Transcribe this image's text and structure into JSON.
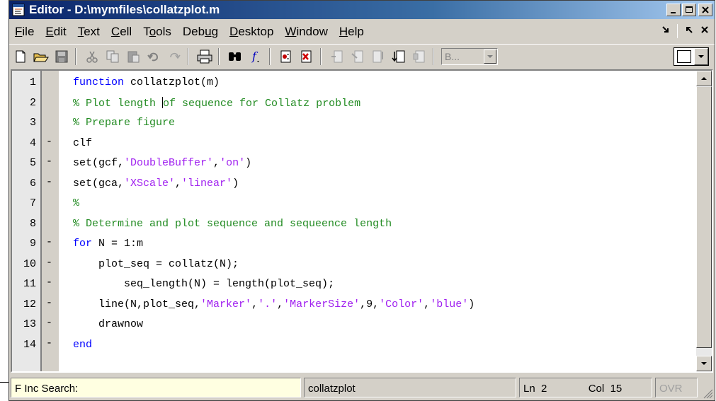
{
  "window": {
    "title": "Editor - D:\\mymfiles\\collatzplot.m"
  },
  "menu": {
    "items": [
      {
        "label": "File",
        "key": "F",
        "rest": "ile"
      },
      {
        "label": "Edit",
        "key": "E",
        "rest": "dit"
      },
      {
        "label": "Text",
        "key": "T",
        "rest": "ext"
      },
      {
        "label": "Cell",
        "key": "C",
        "rest": "ell"
      },
      {
        "label": "Tools",
        "pre": "T",
        "key": "o",
        "rest": "ols"
      },
      {
        "label": "Debug",
        "pre": "Deb",
        "key": "u",
        "rest": "g"
      },
      {
        "label": "Desktop",
        "key": "D",
        "rest": "esktop"
      },
      {
        "label": "Window",
        "key": "W",
        "rest": "indow"
      },
      {
        "label": "Help",
        "key": "H",
        "rest": "elp"
      }
    ],
    "right_undock": "↘",
    "right_close": "✕"
  },
  "toolbar": {
    "stack_combo": "B...",
    "icons": [
      "new-file-icon",
      "open-folder-icon",
      "save-icon",
      "cut-icon",
      "copy-icon",
      "paste-icon",
      "undo-icon",
      "redo-icon",
      "print-icon",
      "find-icon",
      "function-icon",
      "set-breakpoint-icon",
      "clear-breakpoint-icon",
      "step-icon",
      "step-in-icon",
      "step-out-icon",
      "continue-icon",
      "exit-debug-icon"
    ]
  },
  "code_lines": [
    {
      "num": "1",
      "bp": "",
      "indent": "",
      "parts": [
        {
          "t": "kw",
          "v": "function"
        },
        {
          "t": "n",
          "v": " collatzplot(m)"
        }
      ]
    },
    {
      "num": "2",
      "bp": "",
      "indent": "",
      "parts": [
        {
          "t": "cm",
          "v": "% Plot length "
        },
        {
          "t": "caret",
          "v": ""
        },
        {
          "t": "cm",
          "v": "of sequence for Collatz problem"
        }
      ]
    },
    {
      "num": "3",
      "bp": "",
      "indent": "",
      "parts": [
        {
          "t": "cm",
          "v": "% Prepare figure"
        }
      ]
    },
    {
      "num": "4",
      "bp": "-",
      "indent": "",
      "parts": [
        {
          "t": "n",
          "v": "clf"
        }
      ]
    },
    {
      "num": "5",
      "bp": "-",
      "indent": "",
      "parts": [
        {
          "t": "n",
          "v": "set(gcf,"
        },
        {
          "t": "st",
          "v": "'DoubleBuffer'"
        },
        {
          "t": "n",
          "v": ","
        },
        {
          "t": "st",
          "v": "'on'"
        },
        {
          "t": "n",
          "v": ")"
        }
      ]
    },
    {
      "num": "6",
      "bp": "-",
      "indent": "",
      "parts": [
        {
          "t": "n",
          "v": "set(gca,"
        },
        {
          "t": "st",
          "v": "'XScale'"
        },
        {
          "t": "n",
          "v": ","
        },
        {
          "t": "st",
          "v": "'linear'"
        },
        {
          "t": "n",
          "v": ")"
        }
      ]
    },
    {
      "num": "7",
      "bp": "",
      "indent": "",
      "parts": [
        {
          "t": "cm",
          "v": "%"
        }
      ]
    },
    {
      "num": "8",
      "bp": "",
      "indent": "",
      "parts": [
        {
          "t": "cm",
          "v": "% Determine and plot sequence and sequeence length"
        }
      ]
    },
    {
      "num": "9",
      "bp": "-",
      "indent": "",
      "parts": [
        {
          "t": "kw",
          "v": "for"
        },
        {
          "t": "n",
          "v": " N = 1:m"
        }
      ]
    },
    {
      "num": "10",
      "bp": "-",
      "indent": "    ",
      "parts": [
        {
          "t": "n",
          "v": "plot_seq = collatz(N);"
        }
      ]
    },
    {
      "num": "11",
      "bp": "-",
      "indent": "        ",
      "parts": [
        {
          "t": "n",
          "v": "seq_length(N) = length(plot_seq);"
        }
      ]
    },
    {
      "num": "12",
      "bp": "-",
      "indent": "    ",
      "parts": [
        {
          "t": "n",
          "v": "line(N,plot_seq,"
        },
        {
          "t": "st",
          "v": "'Marker'"
        },
        {
          "t": "n",
          "v": ","
        },
        {
          "t": "st",
          "v": "'.'"
        },
        {
          "t": "n",
          "v": ","
        },
        {
          "t": "st",
          "v": "'MarkerSize'"
        },
        {
          "t": "n",
          "v": ",9,"
        },
        {
          "t": "st",
          "v": "'Color'"
        },
        {
          "t": "n",
          "v": ","
        },
        {
          "t": "st",
          "v": "'blue'"
        },
        {
          "t": "n",
          "v": ")"
        }
      ]
    },
    {
      "num": "13",
      "bp": "-",
      "indent": "    ",
      "parts": [
        {
          "t": "n",
          "v": "drawnow"
        }
      ]
    },
    {
      "num": "14",
      "bp": "-",
      "indent": "",
      "parts": [
        {
          "t": "kw",
          "v": "end"
        }
      ]
    }
  ],
  "status": {
    "search_label": "F Inc Search:",
    "function_name": "collatzplot",
    "ln_label": "Ln",
    "ln_value": "2",
    "col_label": "Col",
    "col_value": "15",
    "ovr": "OVR"
  },
  "colors": {
    "keyword": "#0000ff",
    "comment": "#228b22",
    "string": "#a020f0",
    "title_start": "#0a246a",
    "title_end": "#a6caf0"
  }
}
